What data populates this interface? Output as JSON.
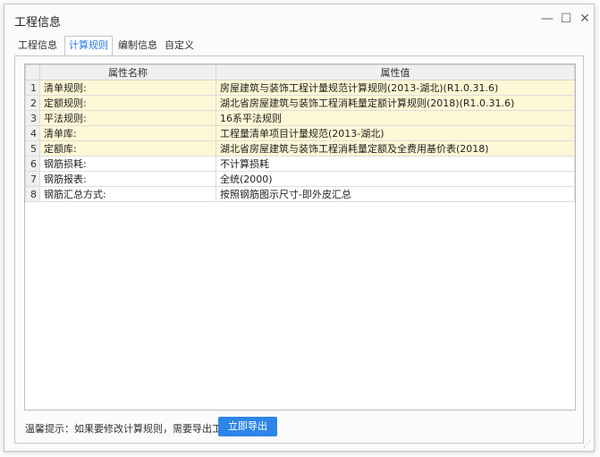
{
  "window": {
    "title": "工程信息",
    "minimize_glyph": "—",
    "maximize_glyph": "☐",
    "close_glyph": "✕"
  },
  "tabs": [
    {
      "label": "工程信息",
      "active": false
    },
    {
      "label": "计算规则",
      "active": true
    },
    {
      "label": "编制信息",
      "active": false
    },
    {
      "label": "自定义",
      "active": false
    }
  ],
  "table": {
    "columns": [
      "属性名称",
      "属性值"
    ],
    "rows": [
      {
        "no": "1",
        "name": "清单规则:",
        "value": "房屋建筑与装饰工程计量规范计算规则(2013-湖北)(R1.0.31.6)",
        "highlight": true
      },
      {
        "no": "2",
        "name": "定额规则:",
        "value": "湖北省房屋建筑与装饰工程消耗量定额计算规则(2018)(R1.0.31.6)",
        "highlight": true
      },
      {
        "no": "3",
        "name": "平法规则:",
        "value": "16系平法规则",
        "highlight": true
      },
      {
        "no": "4",
        "name": "清单库:",
        "value": "工程量清单项目计量规范(2013-湖北)",
        "highlight": true
      },
      {
        "no": "5",
        "name": "定额库:",
        "value": "湖北省房屋建筑与装饰工程消耗量定额及全费用基价表(2018)",
        "highlight": true
      },
      {
        "no": "6",
        "name": "钢筋损耗:",
        "value": "不计算损耗",
        "highlight": false
      },
      {
        "no": "7",
        "name": "钢筋报表:",
        "value": "全统(2000)",
        "highlight": false
      },
      {
        "no": "8",
        "name": "钢筋汇总方式:",
        "value": "按照钢筋图示尺寸-即外皮汇总",
        "highlight": false
      }
    ]
  },
  "footer": {
    "tip": "温馨提示：如果要修改计算规则，需要导出工程",
    "export_label": "立即导出"
  },
  "colors": {
    "accent": "#2d86e6",
    "highlight_row": "#fff8d6",
    "active_tab_text": "#2c7be5"
  }
}
